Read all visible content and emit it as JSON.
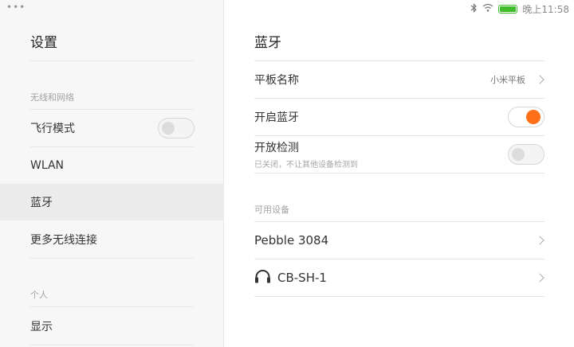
{
  "status_bar": {
    "time": "晚上11:58",
    "icons": [
      "bluetooth-icon",
      "wifi-icon",
      "battery-icon"
    ],
    "battery_color": "#3fbb2c"
  },
  "window": {
    "menu_dots": "•••"
  },
  "sidebar": {
    "title": "设置",
    "sections": [
      {
        "label": "无线和网络"
      },
      {
        "label": "个人"
      }
    ],
    "items": [
      {
        "label": "飞行模式",
        "toggle": false
      },
      {
        "label": "WLAN"
      },
      {
        "label": "蓝牙",
        "selected": true
      },
      {
        "label": "更多无线连接"
      },
      {
        "label": "显示"
      }
    ]
  },
  "main": {
    "title": "蓝牙",
    "device_name": {
      "label": "平板名称",
      "value": "小米平板"
    },
    "enable_bt": {
      "label": "开启蓝牙",
      "toggle": true
    },
    "discoverable": {
      "label": "开放检测",
      "sub": "已关闭，不让其他设备检测到",
      "toggle": false
    },
    "available_header": "可用设备",
    "devices": [
      {
        "name": "Pebble 3084",
        "icon": ""
      },
      {
        "name": "CB-SH-1",
        "icon": "headphones-icon"
      }
    ]
  },
  "colors": {
    "accent": "#ff6f17",
    "sidebar_bg": "#f7f7f7",
    "selected_bg": "#ececec"
  }
}
